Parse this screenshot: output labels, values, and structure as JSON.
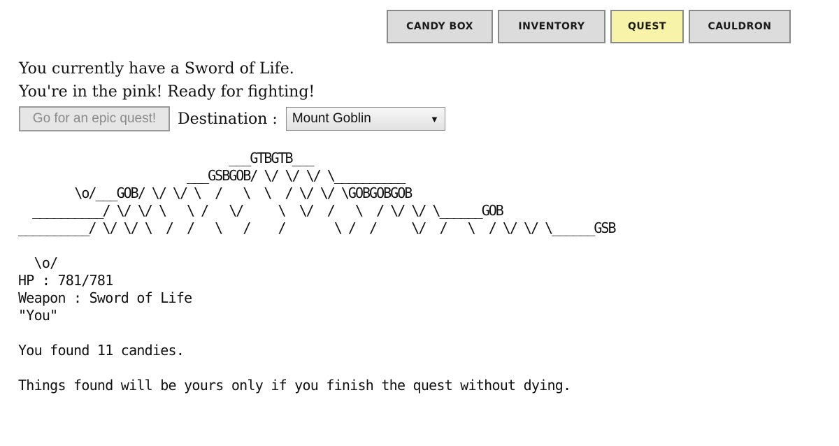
{
  "tabs": {
    "candy_box": "CANDY BOX",
    "inventory": "INVENTORY",
    "quest": "QUEST",
    "cauldron": "CAULDRON",
    "active": "quest"
  },
  "status": {
    "weapon_line": "You currently have a Sword of Life.",
    "health_line": "You're in the pink! Ready for fighting!"
  },
  "quest_controls": {
    "go_button": "Go for an epic quest!",
    "destination_label": "Destination :",
    "destination_value": "Mount Goblin"
  },
  "map": {
    "row1": "                              ___GTBGTB___",
    "row2": "                        ___GSBGOB/ \\/ \\/ \\/ \\__________",
    "row3": "        \\o/___GOB/ \\/ \\/ \\  /   \\  \\  / \\/ \\/ \\GOBGOBGOB",
    "row4": "  __________/ \\/ \\/ \\   \\ /   \\/     \\  \\/  /   \\  / \\/ \\/ \\______GOB",
    "row5": "__________/ \\/ \\/ \\  /  /   \\   /    /       \\ /  /     \\/  /   \\  / \\/ \\/ \\______GSB"
  },
  "player": {
    "figure": "  \\o/",
    "hp": "HP : 781/781",
    "weapon": "Weapon : Sword of Life",
    "name": "\"You\""
  },
  "messages": {
    "found": "You found 11 candies.",
    "warning": "Things found will be yours only if you finish the quest without dying."
  },
  "colors": {
    "active_tab": "#f7f3a8",
    "tab": "#dcdcdc"
  }
}
